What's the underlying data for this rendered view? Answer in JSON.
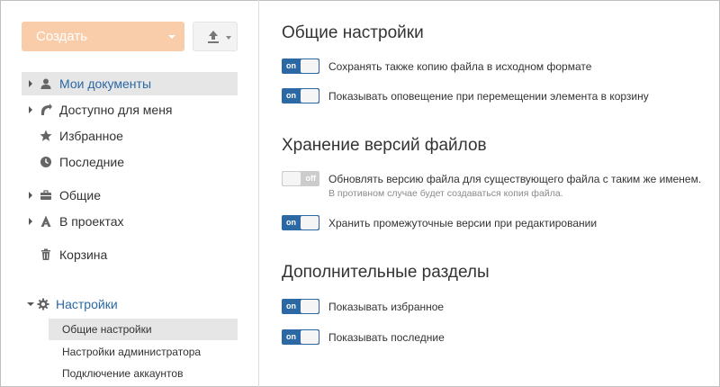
{
  "sidebar": {
    "create_label": "Создать",
    "tree": [
      {
        "label": "Мои документы",
        "icon": "user-icon",
        "has_arrow": true,
        "selected": true
      },
      {
        "label": "Доступно для меня",
        "icon": "share-icon",
        "has_arrow": true,
        "selected": false
      },
      {
        "label": "Избранное",
        "icon": "star-icon",
        "has_arrow": false,
        "selected": false
      },
      {
        "label": "Последние",
        "icon": "clock-icon",
        "has_arrow": false,
        "selected": false
      },
      {
        "label": "Общие",
        "icon": "briefcase-icon",
        "has_arrow": true,
        "selected": false
      },
      {
        "label": "В проектах",
        "icon": "projects-icon",
        "has_arrow": true,
        "selected": false
      },
      {
        "label": "Корзина",
        "icon": "trash-icon",
        "has_arrow": false,
        "selected": false
      }
    ],
    "settings": {
      "label": "Настройки",
      "icon": "gear-icon",
      "items": [
        {
          "label": "Общие настройки",
          "selected": true
        },
        {
          "label": "Настройки администратора",
          "selected": false
        },
        {
          "label": "Подключение аккаунтов",
          "selected": false
        }
      ]
    }
  },
  "main": {
    "sections": [
      {
        "title": "Общие настройки",
        "options": [
          {
            "state": "on",
            "label": "Сохранять также копию файла в исходном формате"
          },
          {
            "state": "on",
            "label": "Показывать оповещение при перемещении элемента в корзину"
          }
        ]
      },
      {
        "title": "Хранение версий файлов",
        "options": [
          {
            "state": "off",
            "label": "Обновлять версию файла для существующего файла с таким же именем.",
            "hint": "В противном случае будет создаваться копия файла."
          },
          {
            "state": "on",
            "label": "Хранить промежуточные версии при редактировании"
          }
        ]
      },
      {
        "title": "Дополнительные разделы",
        "options": [
          {
            "state": "on",
            "label": "Показывать избранное"
          },
          {
            "state": "on",
            "label": "Показывать последние"
          }
        ]
      }
    ]
  },
  "colors": {
    "accent": "#2b68a4",
    "create_button": "#f9cda9",
    "toggle_off": "#cccccc",
    "selected_bg": "#e6e6e6"
  }
}
